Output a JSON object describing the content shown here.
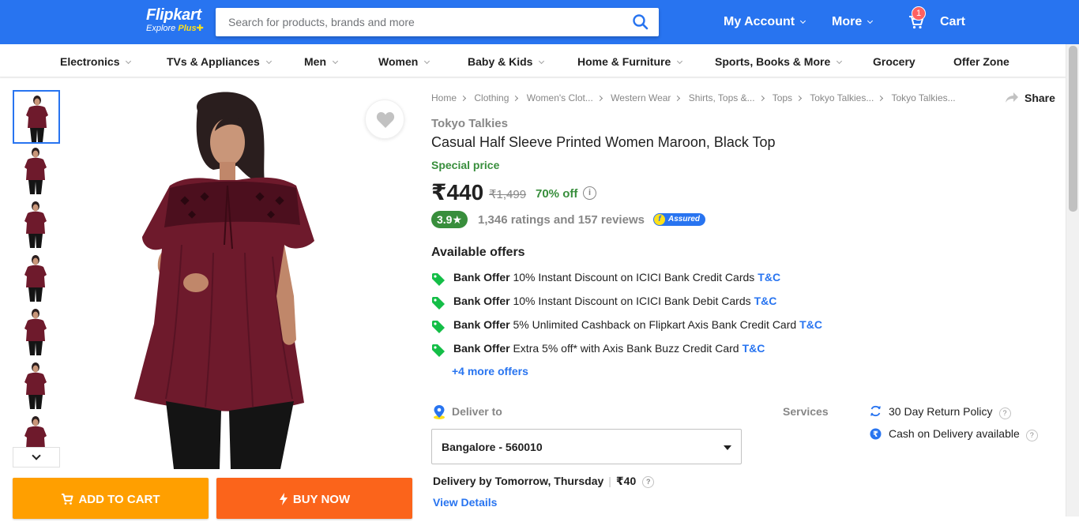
{
  "header": {
    "logo_name": "Flipkart",
    "logo_tag_prefix": "Explore",
    "logo_tag_plus": "Plus",
    "search_placeholder": "Search for products, brands and more",
    "my_account": "My Account",
    "more": "More",
    "cart_label": "Cart",
    "cart_count": "1",
    "icons": [
      "search-icon",
      "cart-icon",
      "chevron-down-icon"
    ]
  },
  "categories": [
    "Electronics",
    "TVs & Appliances",
    "Men",
    "Women",
    "Baby & Kids",
    "Home & Furniture",
    "Sports, Books & More",
    "Grocery",
    "Offer Zone"
  ],
  "gallery": {
    "thumb_count": 8,
    "active_index": 0
  },
  "actions": {
    "add_to_cart": "ADD TO CART",
    "buy_now": "BUY NOW"
  },
  "breadcrumbs": [
    "Home",
    "Clothing",
    "Women's Clot...",
    "Western Wear",
    "Shirts, Tops &...",
    "Tops",
    "Tokyo Talkies...",
    "Tokyo Talkies..."
  ],
  "share_label": "Share",
  "product": {
    "brand": "Tokyo Talkies",
    "title": "Casual Half Sleeve Printed Women Maroon, Black Top",
    "special_price_label": "Special price",
    "price": "₹440",
    "mrp": "₹1,499",
    "discount": "70% off",
    "rating": "3.9★",
    "ratings_reviews": "1,346 ratings and 157 reviews",
    "assured_label": "Assured"
  },
  "offers": {
    "title": "Available offers",
    "items": [
      {
        "type": "Bank Offer",
        "text": "10% Instant Discount on ICICI Bank Credit Cards",
        "tc": "T&C"
      },
      {
        "type": "Bank Offer",
        "text": "10% Instant Discount on ICICI Bank Debit Cards",
        "tc": "T&C"
      },
      {
        "type": "Bank Offer",
        "text": "5% Unlimited Cashback on Flipkart Axis Bank Credit Card",
        "tc": "T&C"
      },
      {
        "type": "Bank Offer",
        "text": "Extra 5% off* with Axis Bank Buzz Credit Card",
        "tc": "T&C"
      }
    ],
    "more": "+4 more offers"
  },
  "delivery": {
    "label": "Deliver to",
    "pincode": "Bangalore - 560010",
    "by": "Delivery by Tomorrow, Thursday",
    "charge": "₹40",
    "view_details": "View Details"
  },
  "services": {
    "label": "Services",
    "items": [
      "30 Day Return Policy",
      "Cash on Delivery available"
    ]
  },
  "colors": {
    "brand_blue": "#2874f0",
    "cart_orange": "#ff9f00",
    "buy_orange": "#fb641b",
    "green": "#388e3c",
    "product_maroon": "#6e1a2c"
  }
}
